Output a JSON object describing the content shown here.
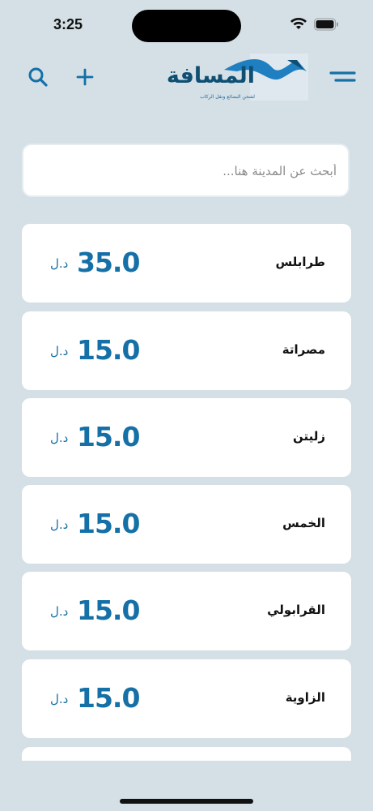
{
  "status_bar": {
    "time": "3:25"
  },
  "header": {
    "logo_text": "المسافة",
    "logo_tagline": "لشحن البضائع ونقل الركاب",
    "icons": [
      "search-icon",
      "plus-icon",
      "menu-icon"
    ]
  },
  "search": {
    "placeholder": "أبحث عن المدينة هنا..."
  },
  "colors": {
    "accent": "#1470a6",
    "background": "#d4dfe6",
    "card": "#ffffff"
  },
  "cities": [
    {
      "name": "طرابلس",
      "price": "35.0",
      "currency": "د.ل"
    },
    {
      "name": "مصراتة",
      "price": "15.0",
      "currency": "د.ل"
    },
    {
      "name": "زليتن",
      "price": "15.0",
      "currency": "د.ل"
    },
    {
      "name": "الخمس",
      "price": "15.0",
      "currency": "د.ل"
    },
    {
      "name": "القرابولي",
      "price": "15.0",
      "currency": "د.ل"
    },
    {
      "name": "الزاوية",
      "price": "15.0",
      "currency": "د.ل"
    }
  ]
}
